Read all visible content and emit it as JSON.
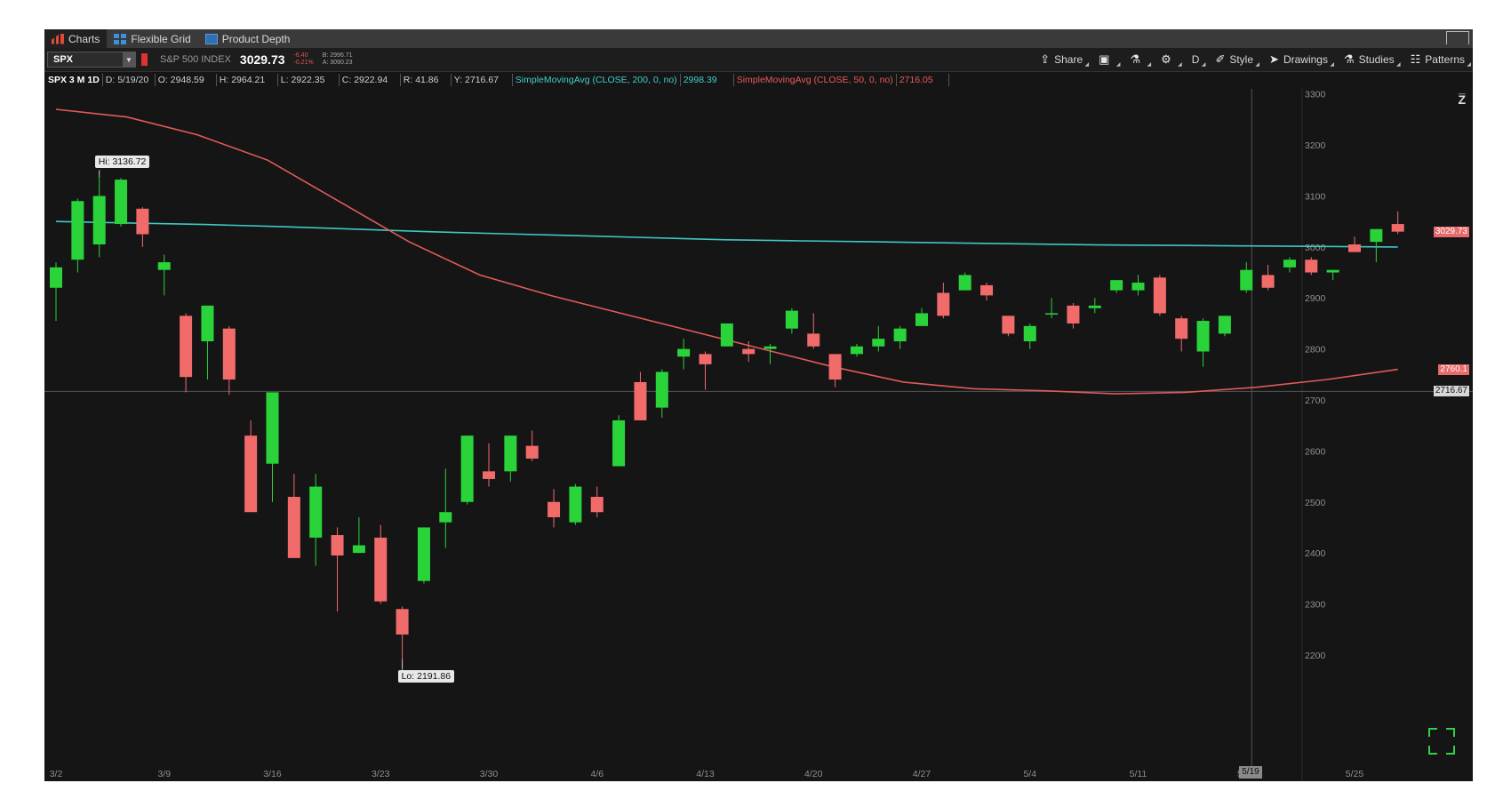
{
  "tabs": [
    {
      "label": "Charts",
      "icon": "bar-chart-icon"
    },
    {
      "label": "Flexible Grid",
      "icon": "grid-icon"
    },
    {
      "label": "Product Depth",
      "icon": "depth-icon"
    }
  ],
  "toolbar": {
    "symbol": "SPX",
    "index_name": "S&P 500 INDEX",
    "last": "3029.73",
    "change": "-6.40",
    "change_pct": "-0.21%",
    "bid": "B: 2996.71",
    "ask": "A: 3090.23",
    "buttons": [
      {
        "label": "Share",
        "glyph": "⇪",
        "icon": "share-icon"
      },
      {
        "label": "",
        "glyph": "▣",
        "icon": "layout-icon"
      },
      {
        "label": "",
        "glyph": "⚗",
        "icon": "flask-icon"
      },
      {
        "label": "",
        "glyph": "⚙",
        "icon": "gear-icon"
      },
      {
        "label": "D",
        "glyph": "",
        "icon": "timeframe-icon"
      },
      {
        "label": "Style",
        "glyph": "✐",
        "icon": "style-icon"
      },
      {
        "label": "Drawings",
        "glyph": "➤",
        "icon": "drawings-icon"
      },
      {
        "label": "Studies",
        "glyph": "⚗",
        "icon": "studies-icon"
      },
      {
        "label": "Patterns",
        "glyph": "☷",
        "icon": "patterns-icon"
      }
    ]
  },
  "studybar": {
    "title": "SPX 3 M 1D",
    "d": "D: 5/19/20",
    "o": "O: 2948.59",
    "h": "H: 2964.21",
    "l": "L: 2922.35",
    "c": "C: 2922.94",
    "r": "R: 41.86",
    "y": "Y: 2716.67",
    "sma200_label": "SimpleMovingAvg (CLOSE, 200, 0, no)",
    "sma200_value": "2998.39",
    "sma50_label": "SimpleMovingAvg (CLOSE, 50, 0, no)",
    "sma50_value": "2716.05"
  },
  "chart": {
    "price_tags": {
      "last": "3029.73",
      "sma50": "2760.1",
      "cross": "2716.67"
    },
    "hi_label": "Hi: 3136.72",
    "lo_label": "Lo: 2191.86",
    "cursor_date": "5/19",
    "colors": {
      "up": "#2ad33a",
      "down": "#f26b6b",
      "sma200": "#3ec9c4",
      "sma50": "#e15a5a",
      "background": "#151515"
    }
  },
  "chart_data": {
    "type": "candlestick",
    "y_ticks": [
      3300,
      3200,
      3100,
      3000,
      2900,
      2800,
      2700,
      2600,
      2500,
      2400,
      2300,
      2200
    ],
    "ylim": [
      2090,
      3310
    ],
    "x_ticks": [
      "3/2",
      "3/9",
      "3/16",
      "3/23",
      "3/30",
      "4/6",
      "4/13",
      "4/20",
      "4/27",
      "5/4",
      "5/11",
      "5/18",
      "5/25"
    ],
    "candles": [
      {
        "o": 2920,
        "h": 2970,
        "l": 2855,
        "c": 2960
      },
      {
        "o": 2975,
        "h": 3095,
        "l": 2950,
        "c": 3090
      },
      {
        "o": 3005,
        "h": 3136.72,
        "l": 2980,
        "c": 3100
      },
      {
        "o": 3045,
        "h": 3135,
        "l": 3040,
        "c": 3132
      },
      {
        "o": 3075,
        "h": 3078,
        "l": 3000,
        "c": 3025
      },
      {
        "o": 2955,
        "h": 2985,
        "l": 2905,
        "c": 2970
      },
      {
        "o": 2865,
        "h": 2870,
        "l": 2715,
        "c": 2745
      },
      {
        "o": 2815,
        "h": 2885,
        "l": 2740,
        "c": 2885
      },
      {
        "o": 2840,
        "h": 2845,
        "l": 2710,
        "c": 2740
      },
      {
        "o": 2630,
        "h": 2660,
        "l": 2480,
        "c": 2480
      },
      {
        "o": 2575,
        "h": 2710,
        "l": 2500,
        "c": 2715
      },
      {
        "o": 2510,
        "h": 2555,
        "l": 2390,
        "c": 2390
      },
      {
        "o": 2430,
        "h": 2555,
        "l": 2375,
        "c": 2530
      },
      {
        "o": 2435,
        "h": 2450,
        "l": 2285,
        "c": 2395
      },
      {
        "o": 2400,
        "h": 2470,
        "l": 2400,
        "c": 2415
      },
      {
        "o": 2430,
        "h": 2455,
        "l": 2300,
        "c": 2305
      },
      {
        "o": 2290,
        "h": 2295,
        "l": 2191.86,
        "c": 2240
      },
      {
        "o": 2345,
        "h": 2450,
        "l": 2340,
        "c": 2450
      },
      {
        "o": 2460,
        "h": 2565,
        "l": 2410,
        "c": 2480
      },
      {
        "o": 2500,
        "h": 2630,
        "l": 2495,
        "c": 2630
      },
      {
        "o": 2560,
        "h": 2615,
        "l": 2530,
        "c": 2545
      },
      {
        "o": 2560,
        "h": 2630,
        "l": 2540,
        "c": 2630
      },
      {
        "o": 2610,
        "h": 2640,
        "l": 2580,
        "c": 2585
      },
      {
        "o": 2500,
        "h": 2525,
        "l": 2450,
        "c": 2470
      },
      {
        "o": 2460,
        "h": 2535,
        "l": 2455,
        "c": 2530
      },
      {
        "o": 2510,
        "h": 2530,
        "l": 2470,
        "c": 2480
      },
      {
        "o": 2570,
        "h": 2670,
        "l": 2570,
        "c": 2660
      },
      {
        "o": 2735,
        "h": 2755,
        "l": 2660,
        "c": 2660
      },
      {
        "o": 2685,
        "h": 2760,
        "l": 2665,
        "c": 2755
      },
      {
        "o": 2785,
        "h": 2820,
        "l": 2760,
        "c": 2800
      },
      {
        "o": 2790,
        "h": 2795,
        "l": 2720,
        "c": 2770
      },
      {
        "o": 2805,
        "h": 2850,
        "l": 2805,
        "c": 2850
      },
      {
        "o": 2800,
        "h": 2815,
        "l": 2775,
        "c": 2790
      },
      {
        "o": 2800,
        "h": 2810,
        "l": 2770,
        "c": 2805
      },
      {
        "o": 2840,
        "h": 2880,
        "l": 2830,
        "c": 2875
      },
      {
        "o": 2830,
        "h": 2870,
        "l": 2800,
        "c": 2805
      },
      {
        "o": 2790,
        "h": 2790,
        "l": 2725,
        "c": 2740
      },
      {
        "o": 2790,
        "h": 2810,
        "l": 2785,
        "c": 2805
      },
      {
        "o": 2805,
        "h": 2845,
        "l": 2795,
        "c": 2820
      },
      {
        "o": 2815,
        "h": 2845,
        "l": 2800,
        "c": 2840
      },
      {
        "o": 2845,
        "h": 2880,
        "l": 2845,
        "c": 2870
      },
      {
        "o": 2910,
        "h": 2930,
        "l": 2860,
        "c": 2865
      },
      {
        "o": 2915,
        "h": 2950,
        "l": 2915,
        "c": 2945
      },
      {
        "o": 2925,
        "h": 2930,
        "l": 2895,
        "c": 2905
      },
      {
        "o": 2865,
        "h": 2865,
        "l": 2825,
        "c": 2830
      },
      {
        "o": 2815,
        "h": 2850,
        "l": 2800,
        "c": 2845
      },
      {
        "o": 2870,
        "h": 2900,
        "l": 2860,
        "c": 2870
      },
      {
        "o": 2885,
        "h": 2890,
        "l": 2840,
        "c": 2850
      },
      {
        "o": 2880,
        "h": 2900,
        "l": 2870,
        "c": 2885
      },
      {
        "o": 2915,
        "h": 2935,
        "l": 2910,
        "c": 2935
      },
      {
        "o": 2915,
        "h": 2945,
        "l": 2905,
        "c": 2930
      },
      {
        "o": 2940,
        "h": 2945,
        "l": 2865,
        "c": 2870
      },
      {
        "o": 2860,
        "h": 2865,
        "l": 2795,
        "c": 2820
      },
      {
        "o": 2795,
        "h": 2860,
        "l": 2765,
        "c": 2855
      },
      {
        "o": 2830,
        "h": 2865,
        "l": 2825,
        "c": 2865
      },
      {
        "o": 2915,
        "h": 2970,
        "l": 2910,
        "c": 2955
      },
      {
        "o": 2945,
        "h": 2965,
        "l": 2915,
        "c": 2920
      },
      {
        "o": 2960,
        "h": 2980,
        "l": 2950,
        "c": 2975
      },
      {
        "o": 2975,
        "h": 2980,
        "l": 2945,
        "c": 2950
      },
      {
        "o": 2950,
        "h": 2955,
        "l": 2935,
        "c": 2955
      },
      {
        "o": 3005,
        "h": 3020,
        "l": 2990,
        "c": 2990
      },
      {
        "o": 3010,
        "h": 3035,
        "l": 2970,
        "c": 3035
      },
      {
        "o": 3045,
        "h": 3070,
        "l": 3025,
        "c": 3030
      }
    ],
    "series": [
      {
        "name": "SimpleMovingAvg (CLOSE, 200, 0, no)",
        "values": [
          3050,
          3047,
          3044,
          3040,
          3035,
          3030,
          3026,
          3022,
          3018,
          3014,
          3012,
          3010,
          3008,
          3006,
          3004,
          3003,
          3002,
          3001,
          3000
        ]
      },
      {
        "name": "SimpleMovingAvg (CLOSE, 50, 0, no)",
        "values": [
          3270,
          3255,
          3220,
          3170,
          3090,
          3010,
          2945,
          2905,
          2870,
          2835,
          2800,
          2765,
          2735,
          2722,
          2718,
          2712,
          2715,
          2725,
          2740,
          2760
        ]
      }
    ]
  }
}
